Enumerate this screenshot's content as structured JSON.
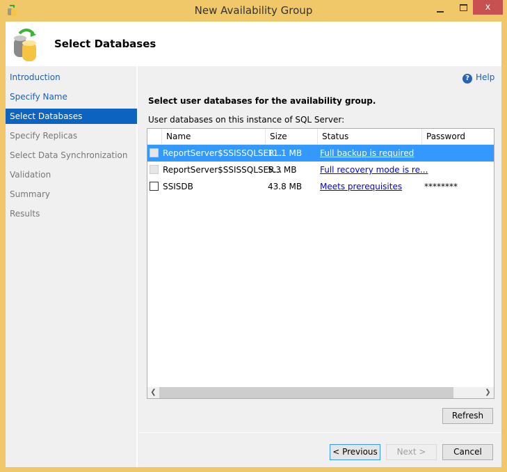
{
  "window": {
    "title": "New Availability Group",
    "close_label": "x"
  },
  "header": {
    "title": "Select Databases"
  },
  "nav": {
    "items": [
      {
        "label": "Introduction",
        "state": "link"
      },
      {
        "label": "Specify Name",
        "state": "link"
      },
      {
        "label": "Select Databases",
        "state": "selected"
      },
      {
        "label": "Specify Replicas",
        "state": "disabled"
      },
      {
        "label": "Select Data Synchronization",
        "state": "disabled"
      },
      {
        "label": "Validation",
        "state": "disabled"
      },
      {
        "label": "Summary",
        "state": "disabled"
      },
      {
        "label": "Results",
        "state": "disabled"
      }
    ]
  },
  "main": {
    "help_label": "Help",
    "instruction": "Select user databases for the availability group.",
    "table_label": "User databases on this instance of SQL Server:",
    "columns": [
      "Name",
      "Size",
      "Status",
      "Password"
    ],
    "rows": [
      {
        "name": "ReportServer$SSISSQLSER...",
        "size": "11.1 MB",
        "status": "Full backup is required",
        "password": "",
        "selected": true,
        "checkbox_enabled": false
      },
      {
        "name": "ReportServer$SSISSQLSER...",
        "size": "5.3 MB",
        "status": "Full recovery mode is re...",
        "password": "",
        "selected": false,
        "checkbox_enabled": false
      },
      {
        "name": "SSISDB",
        "size": "43.8 MB",
        "status": "Meets prerequisites",
        "password": "********",
        "selected": false,
        "checkbox_enabled": true
      }
    ],
    "refresh_label": "Refresh"
  },
  "footer": {
    "previous_label": "< Previous",
    "next_label": "Next >",
    "cancel_label": "Cancel"
  },
  "colors": {
    "frame": "#f0c86a",
    "selection": "#3399ff",
    "nav_selection": "#0c64c0",
    "link": "#0000ee",
    "close": "#c75050"
  }
}
